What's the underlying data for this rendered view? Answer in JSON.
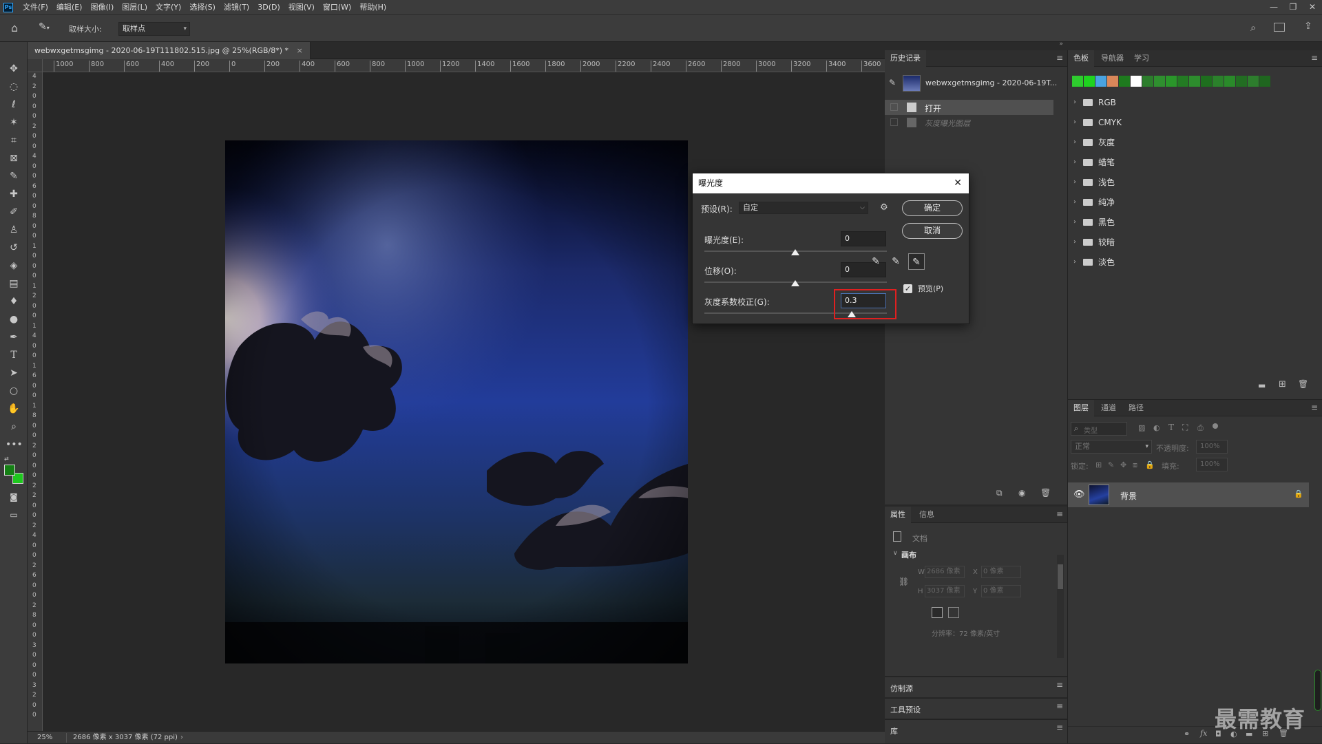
{
  "menubar": {
    "logo": "Ps",
    "items": [
      "文件(F)",
      "编辑(E)",
      "图像(I)",
      "图层(L)",
      "文字(Y)",
      "选择(S)",
      "滤镜(T)",
      "3D(D)",
      "视图(V)",
      "窗口(W)",
      "帮助(H)"
    ]
  },
  "options": {
    "sample_size_label": "取样大小:",
    "sample_size_value": "取样点"
  },
  "document": {
    "tab_title": "webwxgetmsgimg - 2020-06-19T111802.515.jpg @ 25%(RGB/8*) *",
    "ruler_ticks": [
      "1000",
      "800",
      "600",
      "400",
      "200",
      "0",
      "200",
      "400",
      "600",
      "800",
      "1000",
      "1200",
      "1400",
      "1600",
      "1800",
      "2000",
      "2200",
      "2400",
      "2600",
      "2800",
      "3000",
      "3200",
      "3400",
      "3600"
    ],
    "vruler_labels": [
      "4",
      "2",
      "0",
      "0",
      "0",
      "2",
      "0",
      "0",
      "4",
      "0",
      "0",
      "6",
      "0",
      "0",
      "8",
      "0",
      "0",
      "1",
      "0",
      "0",
      "0",
      "1",
      "2",
      "0",
      "0",
      "1",
      "4",
      "0",
      "0",
      "1",
      "6",
      "0",
      "0",
      "1",
      "8",
      "0",
      "0",
      "2",
      "0",
      "0",
      "0",
      "2",
      "2",
      "0",
      "0",
      "2",
      "4",
      "0",
      "0",
      "2",
      "6",
      "0",
      "0",
      "2",
      "8",
      "0",
      "0",
      "3",
      "0",
      "0",
      "0",
      "3",
      "2",
      "0",
      "0"
    ]
  },
  "status": {
    "zoom": "25%",
    "doc_info": "2686 像素 x 3037 像素 (72 ppi)"
  },
  "history": {
    "tab": "历史记录",
    "snapshot": "webwxgetmsgimg - 2020-06-19T...",
    "items": [
      {
        "label": "打开"
      },
      {
        "label": "灰度曝光图层"
      }
    ]
  },
  "properties": {
    "tabs": [
      "属性",
      "信息"
    ],
    "doc_label": "文档",
    "section": "画布",
    "w_label": "W",
    "w_value": "2686 像素",
    "h_label": "H",
    "h_value": "3037 像素",
    "x_label": "X",
    "x_value": "0 像素",
    "y_label": "Y",
    "y_value": "0 像素",
    "resolution": "分辨率：72 像素/英寸"
  },
  "collapsed_panels": [
    "仿制源",
    "工具预设",
    "库"
  ],
  "swatches": {
    "tabs": [
      "色板",
      "导航器",
      "学习"
    ],
    "colors": [
      "#2ecc2e",
      "#1fd31f",
      "#4aa3e0",
      "#d9875a",
      "#1e7a1e",
      "#ffffff",
      "#2c7d2c",
      "#2f8f2f",
      "#2a962a",
      "#237b23",
      "#2d8c2d",
      "#1e6e1e",
      "#2b812b",
      "#2a8a2a",
      "#226d22",
      "#2d7d2d",
      "#1f661f"
    ],
    "groups": [
      "RGB",
      "CMYK",
      "灰度",
      "蜡笔",
      "浅色",
      "纯净",
      "黑色",
      "较暗",
      "淡色"
    ]
  },
  "layers": {
    "tabs": [
      "图层",
      "通道",
      "路径"
    ],
    "search_placeholder": "类型",
    "blend_mode": "正常",
    "opacity_label": "不透明度:",
    "opacity_value": "100%",
    "lock_label": "锁定:",
    "fill_label": "填充:",
    "fill_value": "100%",
    "layer_name": "背景"
  },
  "dialog": {
    "title": "曝光度",
    "preset_label": "预设(R):",
    "preset_value": "自定",
    "exposure_label": "曝光度(E):",
    "exposure_value": "0",
    "offset_label": "位移(O):",
    "offset_value": "0",
    "gamma_label": "灰度系数校正(G):",
    "gamma_value": "0.3",
    "ok_label": "确定",
    "cancel_label": "取消",
    "preview_label": "预览(P)",
    "preview_checked": true,
    "highlight_color": "#e02020"
  },
  "watermark": "最需教育"
}
